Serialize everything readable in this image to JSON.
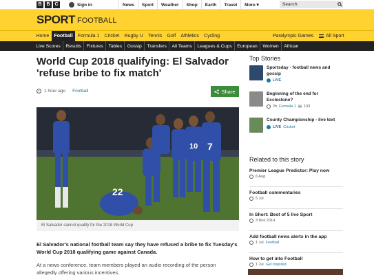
{
  "topbar": {
    "logo": [
      "B",
      "B",
      "C"
    ],
    "signin_label": "Sign in",
    "nav": [
      "News",
      "Sport",
      "Weather",
      "Shop",
      "Earth",
      "Travel",
      "More"
    ],
    "search_placeholder": "Search"
  },
  "header": {
    "brand": "SPORT",
    "section": "FOOTBALL"
  },
  "section_nav": {
    "items": [
      "Home",
      "Football",
      "Formula 1",
      "Cricket",
      "Rugby U",
      "Tennis",
      "Golf",
      "Athletics",
      "Cycling"
    ],
    "active": "Football",
    "right_items": [
      "Paralympic Games",
      "All Sport"
    ]
  },
  "sub_nav": {
    "items": [
      "Live Scores",
      "Results",
      "Fixtures",
      "Tables",
      "Gossip",
      "Transfers",
      "All Teams",
      "Leagues & Cups",
      "European",
      "Women",
      "African"
    ]
  },
  "article": {
    "headline": "World Cup 2018 qualifying: El Salvador 'refuse bribe to fix match'",
    "time": "1 hour ago",
    "category": "Football",
    "share_label": "Share",
    "caption": "El Salvador cannot qualify for the 2018 World Cup",
    "lead": "El Salvador's national football team say they have refused a bribe to fix Tuesday's World Cup 2018 qualifying game against Canada.",
    "paragraph": "At a news conference, team members played an audio recording of the person allegedly offering various incentives."
  },
  "top_stories": {
    "title": "Top Stories",
    "items": [
      {
        "title": "Sportsday - football news and gossip",
        "meta_live": "LIVE",
        "thumb_color": "#2d4a6e"
      },
      {
        "title": "Beginning of the end for Ecclestone?",
        "time": "2h",
        "category": "Formula 1",
        "comments": "103",
        "thumb_color": "#8a8a8a"
      },
      {
        "title": "County Championship - live text",
        "meta_live": "LIVE",
        "category": "Cricket",
        "thumb_color": "#6a8a5a"
      }
    ]
  },
  "related": {
    "title": "Related to this story",
    "items": [
      {
        "title": "Premier League Predictor: Play now",
        "date": "6 Aug",
        "category": ""
      },
      {
        "title": "Football commentaries",
        "date": "5 Jul",
        "category": ""
      },
      {
        "title": "In Short: Best of 5 live Sport",
        "date": "3 Nov 2014",
        "category": ""
      },
      {
        "title": "Add football news alerts in the app",
        "date": "1 Jul",
        "category": "Football"
      },
      {
        "title": "How to get into Football",
        "date": "1 Jul",
        "category": "Get Inspired"
      }
    ]
  },
  "colors": {
    "sport_yellow": "#ffd230",
    "share_green": "#3d8c3d",
    "link_blue": "#1a7a9c"
  }
}
